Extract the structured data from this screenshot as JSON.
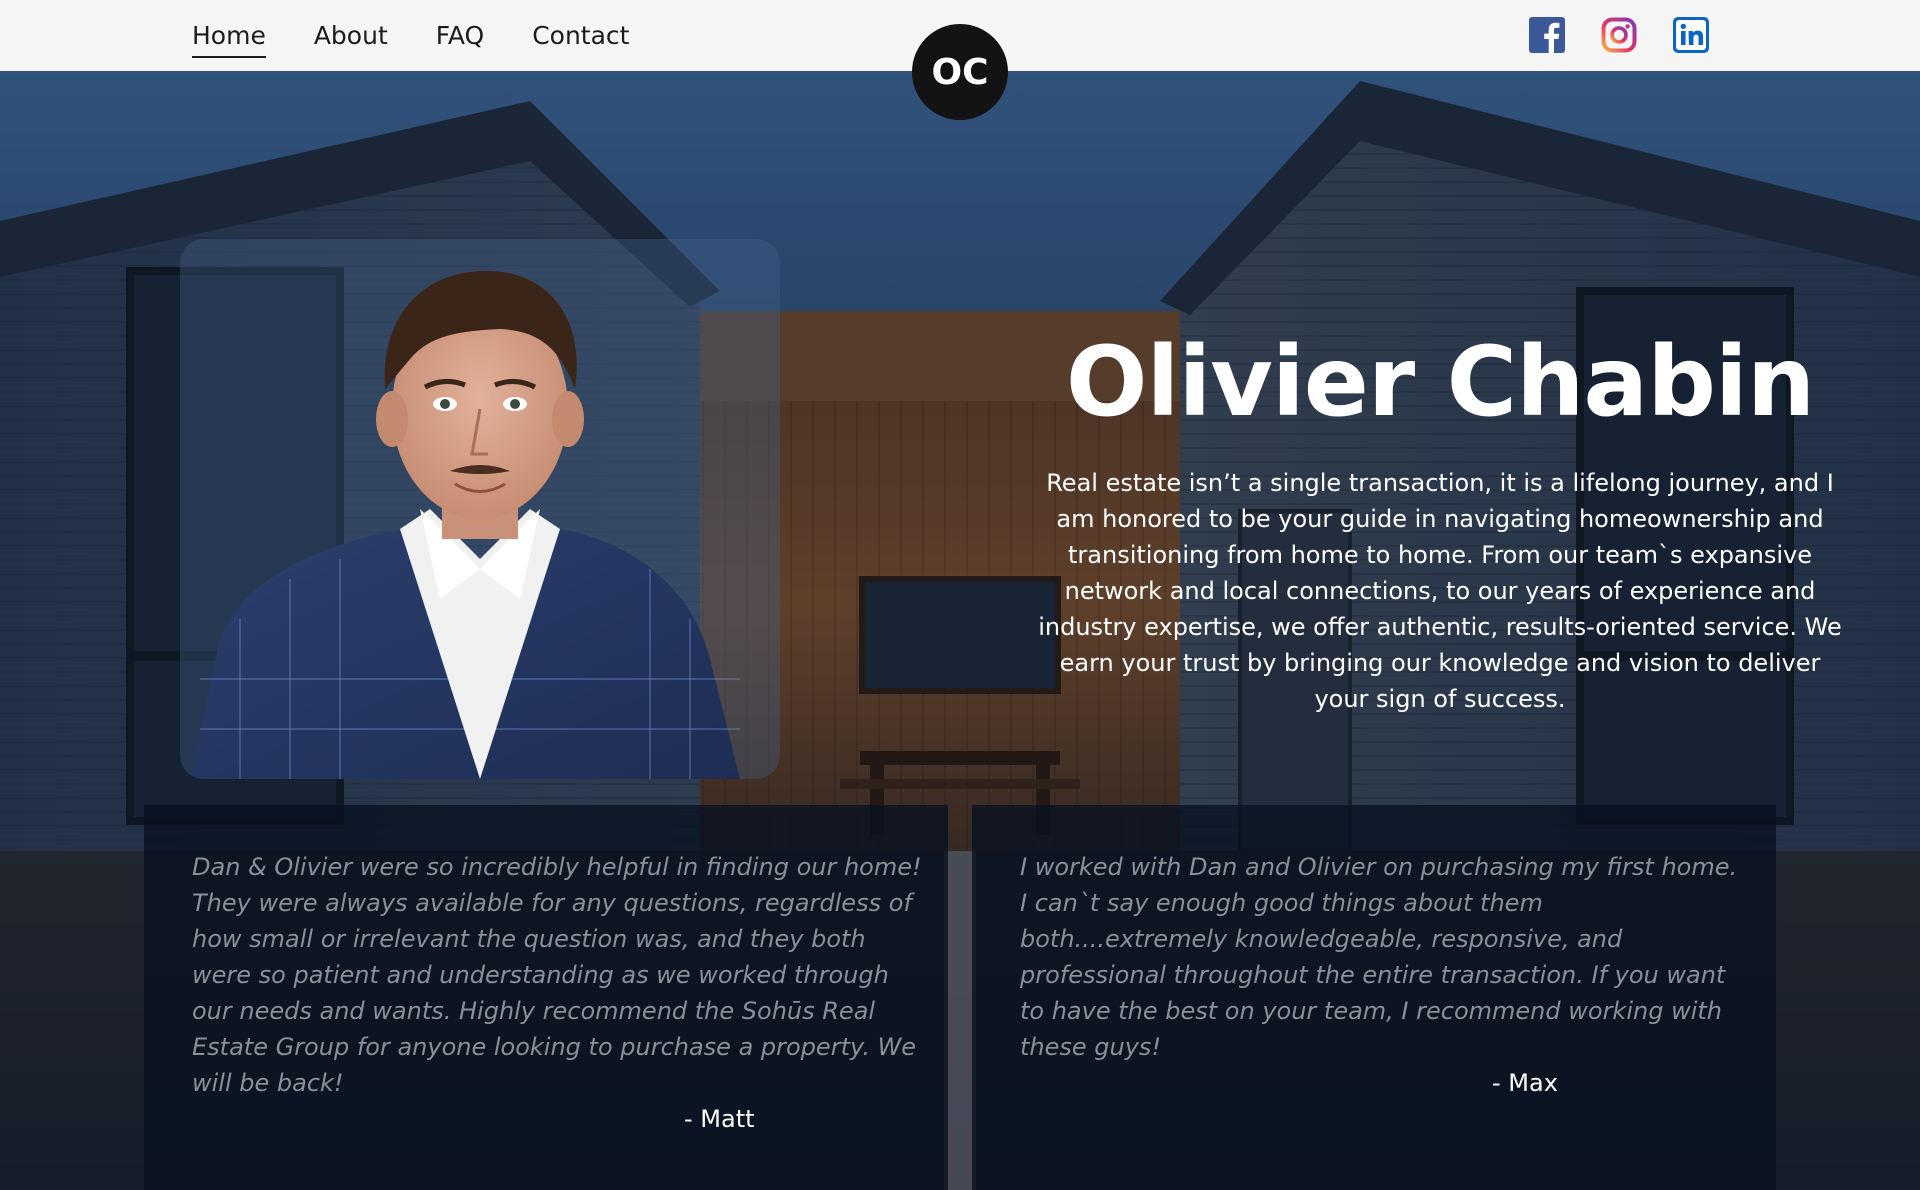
{
  "nav": {
    "items": [
      {
        "label": "Home",
        "active": true
      },
      {
        "label": "About",
        "active": false
      },
      {
        "label": "FAQ",
        "active": false
      },
      {
        "label": "Contact",
        "active": false
      }
    ]
  },
  "logo": {
    "text": "OC"
  },
  "social": [
    "facebook-icon",
    "instagram-icon",
    "linkedin-icon"
  ],
  "colors": {
    "facebook": "#3b5998",
    "linkedin": "#0a66c2",
    "nav_bg": "#f4f5f4",
    "logo_bg": "#131313"
  },
  "hero": {
    "name": "Olivier Chabin",
    "bio": "Real estate isn’t a single transaction, it is a lifelong journey, and I am honored to be your guide in navigating homeownership and transitioning from home to home. From our team`s expansive network and local connections, to our years of experience and industry expertise, we offer authentic, results-oriented service. We earn your trust by bringing our knowledge and vision to deliver your sign of success."
  },
  "testimonials": [
    {
      "quote": "Dan & Olivier were so incredibly helpful in finding our home! They were always available for any questions, regardless of how small or irrelevant the question was, and they both were so patient and understanding as we worked through our needs and wants. Highly recommend the Sohūs Real Estate Group for anyone looking to purchase a property. We will be back!",
      "author": "- Matt"
    },
    {
      "quote": "I worked with Dan and Olivier on purchasing my first home. I can`t say enough good things about them both....extremely knowledgeable, responsive, and professional throughout the entire transaction. If you want to have the best on your team, I recommend working with these guys!",
      "author": "- Max"
    }
  ]
}
